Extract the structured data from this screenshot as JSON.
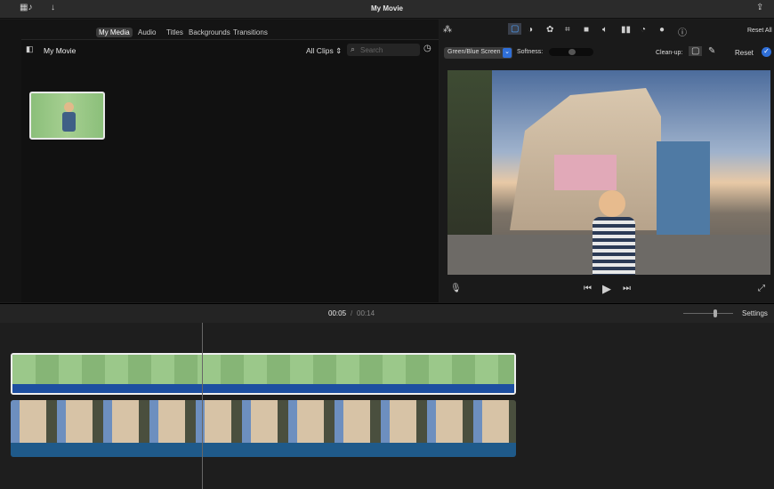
{
  "window": {
    "title": "My Movie"
  },
  "toolbar": {
    "icons": [
      "media-library-icon",
      "import-arrow-icon",
      "share-icon"
    ]
  },
  "browser": {
    "tabs": [
      "My Media",
      "Audio",
      "Titles",
      "Backgrounds",
      "Transitions"
    ],
    "active_tab": "My Media",
    "library_title": "My Movie",
    "filter": "All Clips",
    "search_placeholder": "Search"
  },
  "adjust": {
    "reset_all": "Reset All",
    "effect": "Green/Blue Screen",
    "softness_label": "Softness:",
    "softness_value": 0.5,
    "cleanup_label": "Clean-up:",
    "reset": "Reset"
  },
  "playback": {
    "current": "00:05",
    "separator": "/",
    "total": "00:14",
    "settings": "Settings",
    "zoom_level": 0.6
  },
  "colors": {
    "accent": "#2f6fd8",
    "audio_bar": "#1d4fa1"
  }
}
